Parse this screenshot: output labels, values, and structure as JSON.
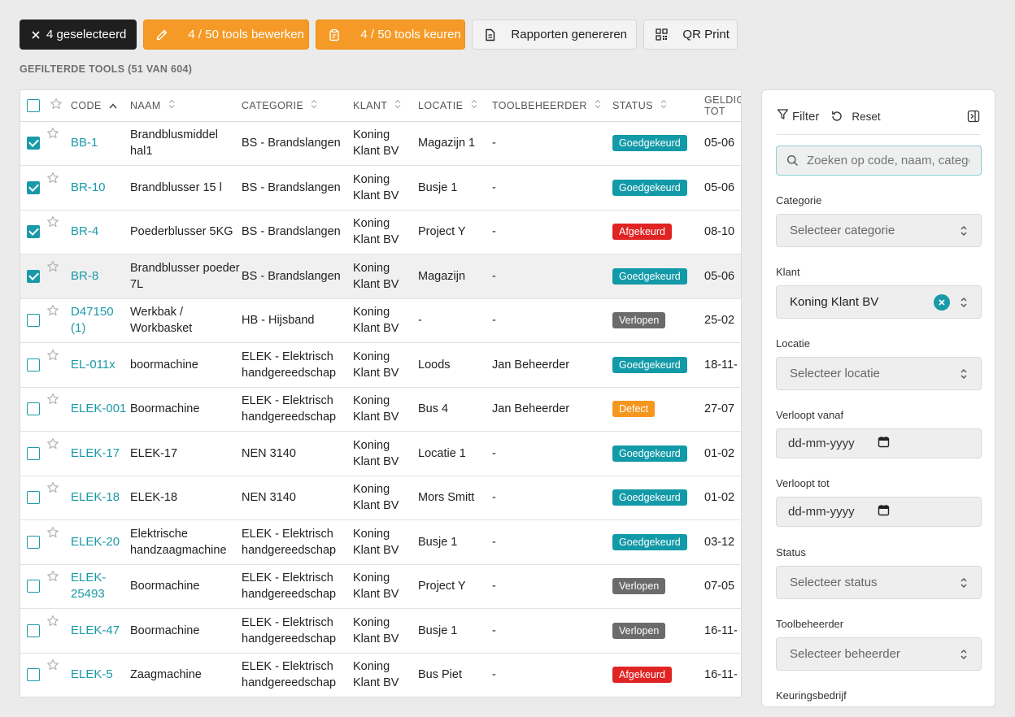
{
  "toolbar": {
    "selected_label": "4 geselecteerd",
    "edit_label": "4 / 50 tools bewerken",
    "inspect_label": "4 / 50 tools keuren",
    "reports_label": "Rapporten genereren",
    "qr_label": "QR Print"
  },
  "count_label": "GEFILTERDE TOOLS (51 VAN 604)",
  "table": {
    "headers": {
      "code": "CODE",
      "naam": "NAAM",
      "categorie": "CATEGORIE",
      "klant": "KLANT",
      "locatie": "LOCATIE",
      "toolbeheerder": "TOOLBEHEERDER",
      "status": "STATUS",
      "geldig": "GELDIG TOT"
    },
    "rows": [
      {
        "code": "BB-1",
        "naam": "Brandblusmiddel hal1",
        "categorie": "BS - Brandslangen",
        "klant": "Koning Klant BV",
        "locatie": "Magazijn 1",
        "beheerder": "-",
        "status": "Goedgekeurd",
        "status_color": "#139aa8",
        "geldig": "05-06"
      },
      {
        "code": "BR-10",
        "naam": "Brandblusser 15 l",
        "categorie": "BS - Brandslangen",
        "klant": "Koning Klant BV",
        "locatie": "Busje 1",
        "beheerder": "-",
        "status": "Goedgekeurd",
        "status_color": "#139aa8",
        "geldig": "05-06"
      },
      {
        "code": "BR-4",
        "naam": "Poederblusser 5KG",
        "categorie": "BS - Brandslangen",
        "klant": "Koning Klant BV",
        "locatie": "Project Y",
        "beheerder": "-",
        "status": "Afgekeurd",
        "status_color": "#e02424",
        "geldig": "08-10"
      },
      {
        "code": "BR-8",
        "naam": "Brandblusser poeder 7L",
        "categorie": "BS - Brandslangen",
        "klant": "Koning Klant BV",
        "locatie": "Magazijn",
        "beheerder": "-",
        "status": "Goedgekeurd",
        "status_color": "#139aa8",
        "geldig": "05-06"
      },
      {
        "code": "D47150 (1)",
        "naam": "Werkbak / Workbasket",
        "categorie": "HB - Hijsband",
        "klant": "Koning Klant BV",
        "locatie": "-",
        "beheerder": "-",
        "status": "Verlopen",
        "status_color": "#6b6b6b",
        "geldig": "25-02"
      },
      {
        "code": "EL-011x",
        "naam": "boormachine",
        "categorie": "ELEK - Elektrisch handgereedschap",
        "klant": "Koning Klant BV",
        "locatie": "Loods",
        "beheerder": "Jan Beheerder",
        "status": "Goedgekeurd",
        "status_color": "#139aa8",
        "geldig": "18-11-"
      },
      {
        "code": "ELEK-001",
        "naam": "Boormachine",
        "categorie": "ELEK - Elektrisch handgereedschap",
        "klant": "Koning Klant BV",
        "locatie": "Bus 4",
        "beheerder": "Jan Beheerder",
        "status": "Defect",
        "status_color": "#f5961d",
        "geldig": "27-07"
      },
      {
        "code": "ELEK-17",
        "naam": "ELEK-17",
        "categorie": "NEN 3140",
        "klant": "Koning Klant BV",
        "locatie": "Locatie 1",
        "beheerder": "-",
        "status": "Goedgekeurd",
        "status_color": "#139aa8",
        "geldig": "01-02"
      },
      {
        "code": "ELEK-18",
        "naam": "ELEK-18",
        "categorie": "NEN 3140",
        "klant": "Koning Klant BV",
        "locatie": "Mors Smitt",
        "beheerder": "-",
        "status": "Goedgekeurd",
        "status_color": "#139aa8",
        "geldig": "01-02"
      },
      {
        "code": "ELEK-20",
        "naam": "Elektrische handzaagmachine",
        "categorie": "ELEK - Elektrisch handgereedschap",
        "klant": "Koning Klant BV",
        "locatie": "Busje 1",
        "beheerder": "-",
        "status": "Goedgekeurd",
        "status_color": "#139aa8",
        "geldig": "03-12"
      },
      {
        "code": "ELEK-25493",
        "naam": "Boormachine",
        "categorie": "ELEK - Elektrisch handgereedschap",
        "klant": "Koning Klant BV",
        "locatie": "Project Y",
        "beheerder": "-",
        "status": "Verlopen",
        "status_color": "#6b6b6b",
        "geldig": "07-05"
      },
      {
        "code": "ELEK-47",
        "naam": "Boormachine",
        "categorie": "ELEK - Elektrisch handgereedschap",
        "klant": "Koning Klant BV",
        "locatie": "Busje 1",
        "beheerder": "-",
        "status": "Verlopen",
        "status_color": "#6b6b6b",
        "geldig": "16-11-"
      },
      {
        "code": "ELEK-5",
        "naam": "Zaagmachine",
        "categorie": "ELEK - Elektrisch handgereedschap",
        "klant": "Koning Klant BV",
        "locatie": "Bus Piet",
        "beheerder": "-",
        "status": "Afgekeurd",
        "status_color": "#e02424",
        "geldig": "16-11-"
      }
    ],
    "checked": [
      true,
      true,
      true,
      true,
      false,
      false,
      false,
      false,
      false,
      false,
      false,
      false,
      false
    ]
  },
  "filter": {
    "title": "Filter",
    "reset_label": "Reset",
    "search_placeholder": "Zoeken op code, naam, categorie",
    "categorie_label": "Categorie",
    "categorie_placeholder": "Selecteer categorie",
    "klant_label": "Klant",
    "klant_value": "Koning Klant BV",
    "locatie_label": "Locatie",
    "locatie_placeholder": "Selecteer locatie",
    "verloopt_vanaf_label": "Verloopt vanaf",
    "verloopt_vanaf_value": "dd-mm-yyyy",
    "verloopt_tot_label": "Verloopt tot",
    "verloopt_tot_value": "dd-mm-yyyy",
    "status_label": "Status",
    "status_placeholder": "Selecteer status",
    "beheerder_label": "Toolbeheerder",
    "beheerder_placeholder": "Selecteer beheerder",
    "keuringsbedrijf_label": "Keuringsbedrijf"
  },
  "colors": {
    "accent": "#1a9aa8",
    "orange": "#f59a26",
    "dark": "#1f1f1f"
  }
}
